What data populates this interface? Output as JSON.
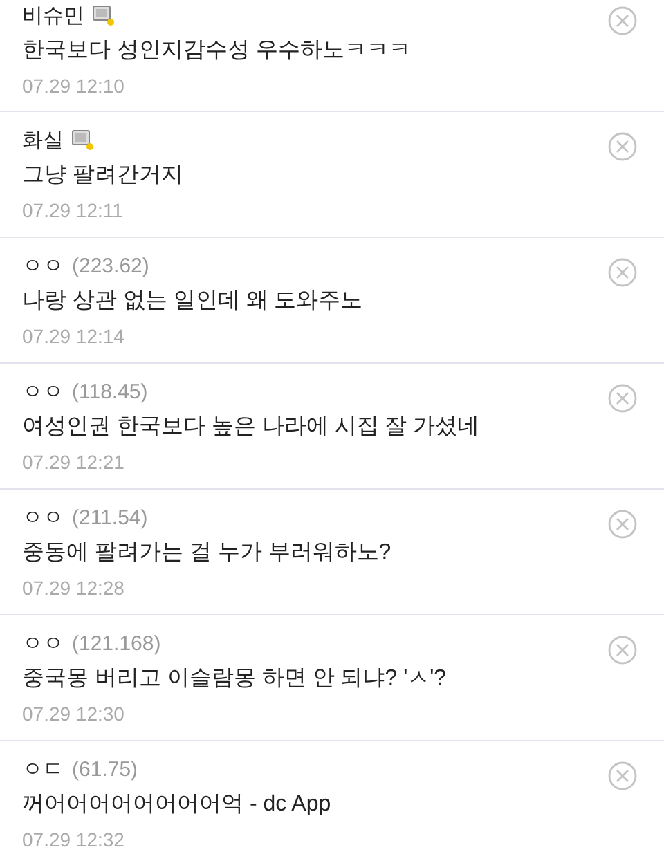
{
  "comments": [
    {
      "kind": "member",
      "name": "비슈민",
      "text": "한국보다 성인지감수성 우수하노ㅋㅋㅋ",
      "time": "07.29 12:10"
    },
    {
      "kind": "member",
      "name": "화실",
      "text": "그냥 팔려간거지",
      "time": "07.29 12:11"
    },
    {
      "kind": "guest",
      "name": "ㅇㅇ",
      "ip": "(223.62)",
      "text": "나랑 상관 없는 일인데 왜 도와주노",
      "time": "07.29 12:14"
    },
    {
      "kind": "guest",
      "name": "ㅇㅇ",
      "ip": "(118.45)",
      "text": "여성인권 한국보다 높은 나라에 시집 잘 가셨네",
      "time": "07.29 12:21"
    },
    {
      "kind": "guest",
      "name": "ㅇㅇ",
      "ip": "(211.54)",
      "text": "중동에 팔려가는 걸 누가 부러워하노?",
      "time": "07.29 12:28"
    },
    {
      "kind": "guest",
      "name": "ㅇㅇ",
      "ip": "(121.168)",
      "text": "중국몽 버리고 이슬람몽 하면 안 되냐? 'ㅅ'?",
      "time": "07.29 12:30"
    },
    {
      "kind": "guest",
      "name": "ㅇㄷ",
      "ip": "(61.75)",
      "text": "꺼어어어어어어어어억 - dc App",
      "time": "07.29 12:32"
    }
  ]
}
